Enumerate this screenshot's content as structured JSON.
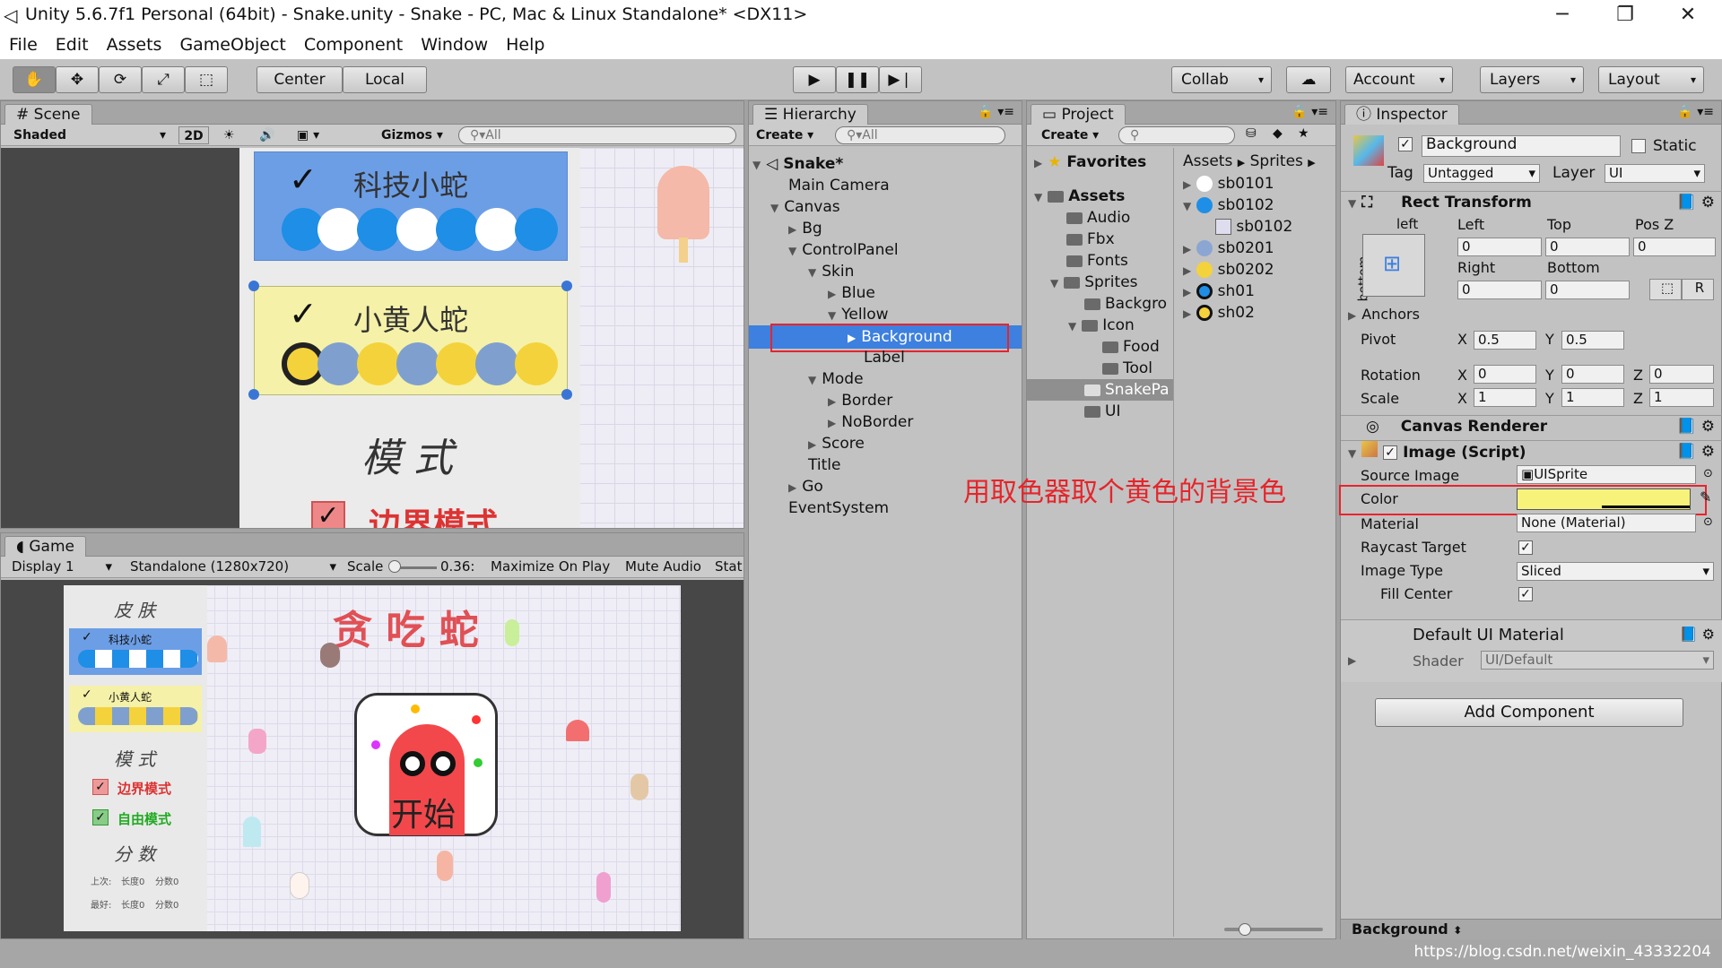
{
  "window": {
    "title": "Unity 5.6.7f1 Personal (64bit) - Snake.unity - Snake - PC, Mac & Linux Standalone* <DX11>"
  },
  "menu": [
    "File",
    "Edit",
    "Assets",
    "GameObject",
    "Component",
    "Window",
    "Help"
  ],
  "toolbar": {
    "center": "Center",
    "local": "Local",
    "collab": "Collab",
    "account": "Account",
    "layers": "Layers",
    "layout": "Layout"
  },
  "scene": {
    "tab": "Scene",
    "shading": "Shaded",
    "mode2d": "2D",
    "gizmos": "Gizmos",
    "search": "All",
    "skin_blue": "科技小蛇",
    "skin_yellow": "小黄人蛇",
    "mode_title": "模 式",
    "border_mode": "边界模式"
  },
  "game": {
    "tab": "Game",
    "display": "Display 1",
    "resolution": "Standalone (1280x720)",
    "scale_label": "Scale",
    "scale_value": "0.36:",
    "maximize": "Maximize On Play",
    "mute": "Mute Audio",
    "stats": "Stat",
    "title": "贪 吃 蛇",
    "skin_header": "皮 肤",
    "skin_blue": "科技小蛇",
    "skin_yellow": "小黄人蛇",
    "mode_header": "模 式",
    "border_mode": "边界模式",
    "free_mode": "自由模式",
    "score_header": "分 数",
    "last_label": "上次:",
    "last_length": "长度0",
    "last_score": "分数0",
    "best_label": "最好:",
    "best_length": "长度0",
    "best_score": "分数0",
    "start": "开始"
  },
  "hierarchy": {
    "tab": "Hierarchy",
    "create": "Create",
    "search": "All",
    "scene_name": "Snake*",
    "items": [
      "Main Camera",
      "Canvas",
      "Bg",
      "ControlPanel",
      "Skin",
      "Blue",
      "Yellow",
      "Background",
      "Label",
      "Mode",
      "Border",
      "NoBorder",
      "Score",
      "Title",
      "Go",
      "EventSystem"
    ]
  },
  "project": {
    "tab": "Project",
    "create": "Create",
    "favorites": "Favorites",
    "assets": "Assets",
    "folders": [
      "Audio",
      "Fbx",
      "Fonts",
      "Sprites",
      "Backgro",
      "Icon",
      "Food",
      "Tool",
      "SnakePa",
      "UI"
    ],
    "breadcrumb_assets": "Assets",
    "breadcrumb_sprites": "Sprites",
    "files": [
      "sb0101",
      "sb0102",
      "sb0102",
      "sb0201",
      "sb0202",
      "sh01",
      "sh02"
    ]
  },
  "annotation": "用取色器取个黄色的背景色",
  "inspector": {
    "tab": "Inspector",
    "object_name": "Background",
    "static": "Static",
    "tag_label": "Tag",
    "tag": "Untagged",
    "layer_label": "Layer",
    "layer": "UI",
    "rect_transform": "Rect Transform",
    "anchor_left": "left",
    "anchor_bottom": "bottom",
    "left_label": "Left",
    "top_label": "Top",
    "posz_label": "Pos Z",
    "left": "0",
    "top": "0",
    "posz": "0",
    "right_label": "Right",
    "bottom_label": "Bottom",
    "right": "0",
    "bottom": "0",
    "r_button": "R",
    "anchors": "Anchors",
    "pivot": "Pivot",
    "pivot_x": "0.5",
    "pivot_y": "0.5",
    "rotation": "Rotation",
    "rot_x": "0",
    "rot_y": "0",
    "rot_z": "0",
    "scale": "Scale",
    "scale_x": "1",
    "scale_y": "1",
    "scale_z": "1",
    "canvas_renderer": "Canvas Renderer",
    "image_script": "Image (Script)",
    "source_image_label": "Source Image",
    "source_image": "UISprite",
    "color_label": "Color",
    "color_value": "#f7f27a",
    "material_label": "Material",
    "material": "None (Material)",
    "raycast_label": "Raycast Target",
    "image_type_label": "Image Type",
    "image_type": "Sliced",
    "fill_center_label": "Fill Center",
    "default_material": "Default UI Material",
    "shader_label": "Shader",
    "shader": "UI/Default",
    "add_component": "Add Component",
    "preview": "Background"
  },
  "watermark": "https://blog.csdn.net/weixin_43332204",
  "colors": {
    "selection": "#3d80df",
    "highlight_box": "#e8242b",
    "annotation": "#e5252b",
    "snake_blue": "#1e8ee6",
    "snake_yellow": "#f4d23c",
    "snake_grey": "#7fa0cf",
    "start_red": "#f2484c"
  }
}
